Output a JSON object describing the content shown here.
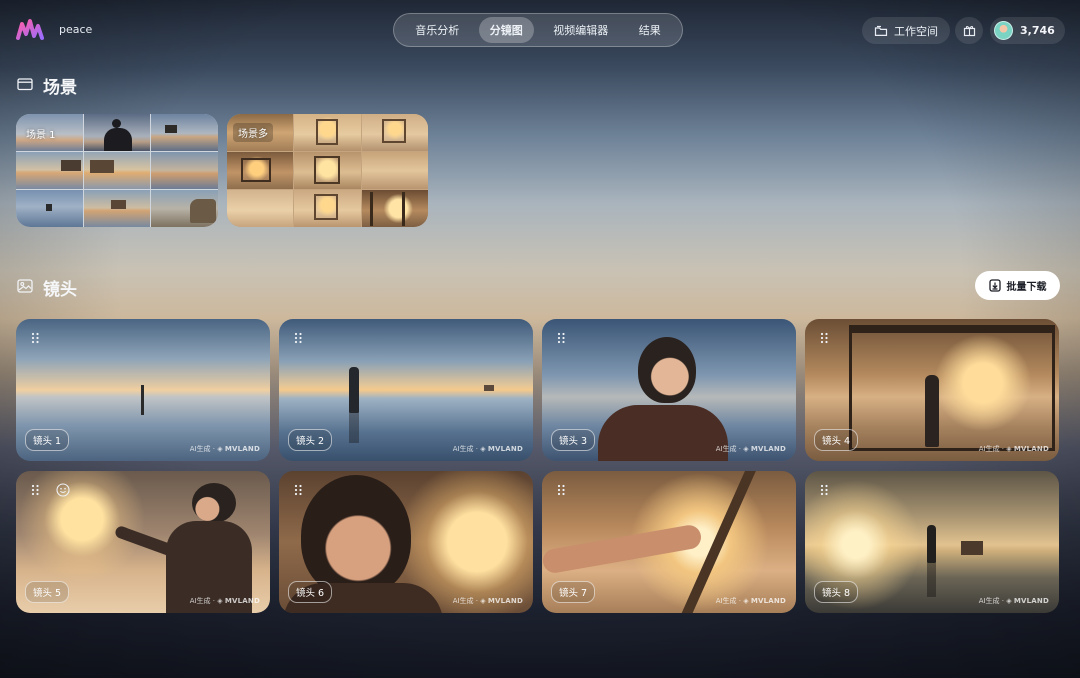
{
  "app": {
    "brand": "peace"
  },
  "nav": {
    "tabs": [
      {
        "label": "音乐分析",
        "active": false
      },
      {
        "label": "分镜图",
        "active": true
      },
      {
        "label": "视频编辑器",
        "active": false
      },
      {
        "label": "结果",
        "active": false
      }
    ]
  },
  "header": {
    "workspace_label": "工作空间",
    "credits": "3,746"
  },
  "scenes": {
    "title": "场景",
    "items": [
      {
        "label": "场景 1"
      },
      {
        "label": "场景多"
      }
    ]
  },
  "shots": {
    "title": "镜头",
    "download_label": "批量下载",
    "watermark_ai": "AI生成",
    "watermark_brand": "MVLAND",
    "items": [
      {
        "label": "镜头 1"
      },
      {
        "label": "镜头 2"
      },
      {
        "label": "镜头 3"
      },
      {
        "label": "镜头 4"
      },
      {
        "label": "镜头 5"
      },
      {
        "label": "镜头 6"
      },
      {
        "label": "镜头 7"
      },
      {
        "label": "镜头 8"
      }
    ]
  },
  "icons": {
    "logo": "brand-logo-icon",
    "workspace": "folder-icon",
    "gift": "gift-icon",
    "scenes": "clapperboard-icon",
    "shots": "image-icon",
    "download": "download-icon",
    "drag": "drag-handle-icon",
    "emoji": "smile-icon"
  },
  "colors": {
    "logo_gradient": [
      "#ff5ea8",
      "#9b6dff"
    ],
    "primary_button": "#ffffff"
  }
}
